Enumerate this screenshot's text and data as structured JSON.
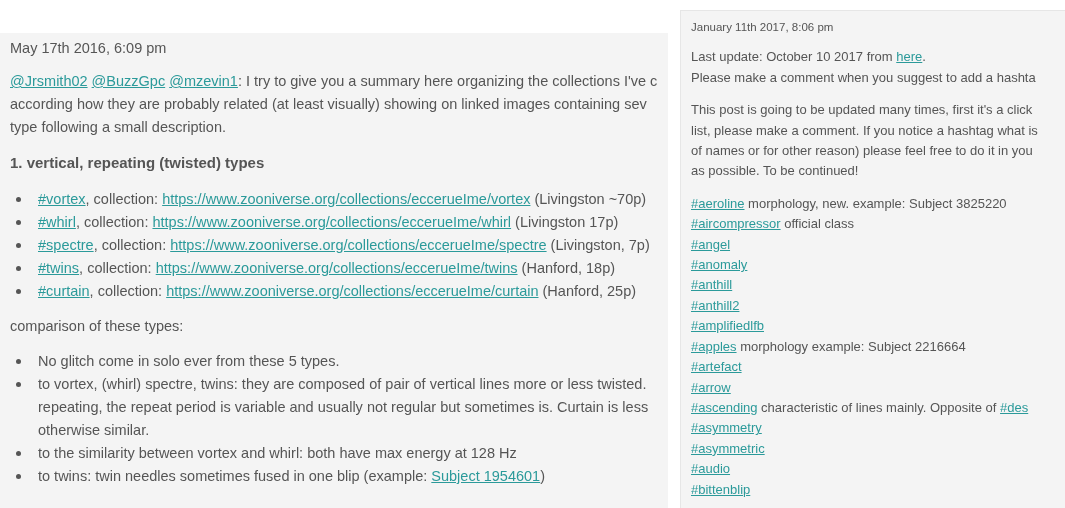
{
  "posts": [
    {
      "date": "May 17th 2016, 6:09 pm",
      "blocks": [
        {
          "kind": "paragraph",
          "lines": [
            [
              {
                "kind": "mention",
                "text": "@Jrsmith02"
              },
              {
                "kind": "mention",
                "text": "@BuzzGpc"
              },
              {
                "kind": "mention",
                "text": "@mzevin1"
              },
              {
                "kind": "text",
                "text": ": I try to give you a summary here organizing the collections I've c"
              }
            ],
            [
              {
                "kind": "text",
                "text": "according how they are probably related (at least visually) showing on linked images containing sev"
              }
            ],
            [
              {
                "kind": "text",
                "text": "type following a small description."
              }
            ]
          ]
        },
        {
          "kind": "heading",
          "text": "1. vertical, repeating (twisted) types"
        },
        {
          "kind": "bullets",
          "items": [
            [
              [
                {
                  "kind": "hashtag",
                  "text": "#vortex"
                },
                {
                  "kind": "text",
                  "text": ", collection: "
                },
                {
                  "kind": "url",
                  "text": "https://www.zooniverse.org/collections/eccerueIme/vortex"
                },
                {
                  "kind": "text",
                  "text": " (Livingston ~70p)"
                }
              ]
            ],
            [
              [
                {
                  "kind": "hashtag",
                  "text": "#whirl"
                },
                {
                  "kind": "text",
                  "text": ", collection: "
                },
                {
                  "kind": "url",
                  "text": "https://www.zooniverse.org/collections/eccerueIme/whirl"
                },
                {
                  "kind": "text",
                  "text": " (Livingston 17p)"
                }
              ]
            ],
            [
              [
                {
                  "kind": "hashtag",
                  "text": "#spectre"
                },
                {
                  "kind": "text",
                  "text": ", collection: "
                },
                {
                  "kind": "url",
                  "text": "https://www.zooniverse.org/collections/eccerueIme/spectre"
                },
                {
                  "kind": "text",
                  "text": " (Livingston, 7p)"
                }
              ]
            ],
            [
              [
                {
                  "kind": "hashtag",
                  "text": "#twins"
                },
                {
                  "kind": "text",
                  "text": ", collection: "
                },
                {
                  "kind": "url",
                  "text": "https://www.zooniverse.org/collections/eccerueIme/twins"
                },
                {
                  "kind": "text",
                  "text": " (Hanford, 18p)"
                }
              ]
            ],
            [
              [
                {
                  "kind": "hashtag",
                  "text": "#curtain"
                },
                {
                  "kind": "text",
                  "text": ", collection: "
                },
                {
                  "kind": "url",
                  "text": "https://www.zooniverse.org/collections/eccerueIme/curtain"
                },
                {
                  "kind": "text",
                  "text": " (Hanford, 25p)"
                }
              ]
            ]
          ]
        },
        {
          "kind": "paragraph",
          "lines": [
            [
              {
                "kind": "text",
                "text": "comparison of these types:"
              }
            ]
          ]
        },
        {
          "kind": "bullets",
          "items": [
            [
              [
                {
                  "kind": "text",
                  "text": "No glitch come in solo ever from these 5 types."
                }
              ]
            ],
            [
              [
                {
                  "kind": "text",
                  "text": "to vortex, (whirl) spectre, twins: they are composed of pair of vertical lines more or less twisted."
                }
              ],
              [
                {
                  "kind": "text",
                  "text": "repeating, the repeat period is variable and usually not regular but sometimes is. Curtain is less"
                }
              ],
              [
                {
                  "kind": "text",
                  "text": "otherwise similar."
                }
              ]
            ],
            [
              [
                {
                  "kind": "text",
                  "text": "to the similarity between vortex and whirl: both have max energy at 128 Hz"
                }
              ]
            ],
            [
              [
                {
                  "kind": "text",
                  "text": "to twins: twin needles sometimes fused in one blip (example: "
                },
                {
                  "kind": "link",
                  "text": "Subject 1954601"
                },
                {
                  "kind": "text",
                  "text": ")"
                }
              ]
            ]
          ]
        }
      ]
    },
    {
      "date": "January 11th 2017, 8:06 pm",
      "blocks": [
        {
          "kind": "paragraph",
          "lines": [
            [
              {
                "kind": "text",
                "text": "Last update: October 10 2017 from "
              },
              {
                "kind": "link",
                "text": "here"
              },
              {
                "kind": "text",
                "text": "."
              }
            ],
            [
              {
                "kind": "text",
                "text": "Please make a comment when you suggest to add a hashta"
              }
            ]
          ]
        },
        {
          "kind": "paragraph",
          "lines": [
            [
              {
                "kind": "text",
                "text": "This post is going to be updated many times, first it's a click"
              }
            ],
            [
              {
                "kind": "text",
                "text": "list, please make a comment. If you notice a hashtag what is"
              }
            ],
            [
              {
                "kind": "text",
                "text": "of names or for other reason) please feel free to do it in you"
              }
            ],
            [
              {
                "kind": "text",
                "text": "as possible. To be continued!"
              }
            ]
          ]
        },
        {
          "kind": "entries",
          "items": [
            [
              {
                "kind": "hashtag",
                "text": "#aeroline"
              },
              {
                "kind": "text",
                "text": " morphology, new. example: Subject 3825220"
              }
            ],
            [
              {
                "kind": "hashtag",
                "text": "#aircompressor"
              },
              {
                "kind": "text",
                "text": " official class"
              }
            ],
            [
              {
                "kind": "hashtag",
                "text": "#angel"
              }
            ],
            [
              {
                "kind": "hashtag",
                "text": "#anomaly"
              }
            ],
            [
              {
                "kind": "hashtag",
                "text": "#anthill"
              }
            ],
            [
              {
                "kind": "hashtag",
                "text": "#anthill2"
              }
            ],
            [
              {
                "kind": "hashtag",
                "text": "#amplifiedlfb"
              }
            ],
            [
              {
                "kind": "hashtag",
                "text": "#apples"
              },
              {
                "kind": "text",
                "text": " morphology example: Subject 2216664"
              }
            ],
            [
              {
                "kind": "hashtag",
                "text": "#artefact"
              }
            ],
            [
              {
                "kind": "hashtag",
                "text": "#arrow"
              }
            ],
            [
              {
                "kind": "hashtag",
                "text": "#ascending"
              },
              {
                "kind": "text",
                "text": " characteristic of lines mainly. Opposite of "
              },
              {
                "kind": "hashtag",
                "text": "#des"
              }
            ],
            [
              {
                "kind": "hashtag",
                "text": "#asymmetry"
              }
            ],
            [
              {
                "kind": "hashtag",
                "text": "#asymmetric"
              }
            ],
            [
              {
                "kind": "hashtag",
                "text": "#audio"
              }
            ],
            [
              {
                "kind": "hashtag",
                "text": "#bittenblip"
              }
            ]
          ]
        }
      ]
    }
  ]
}
